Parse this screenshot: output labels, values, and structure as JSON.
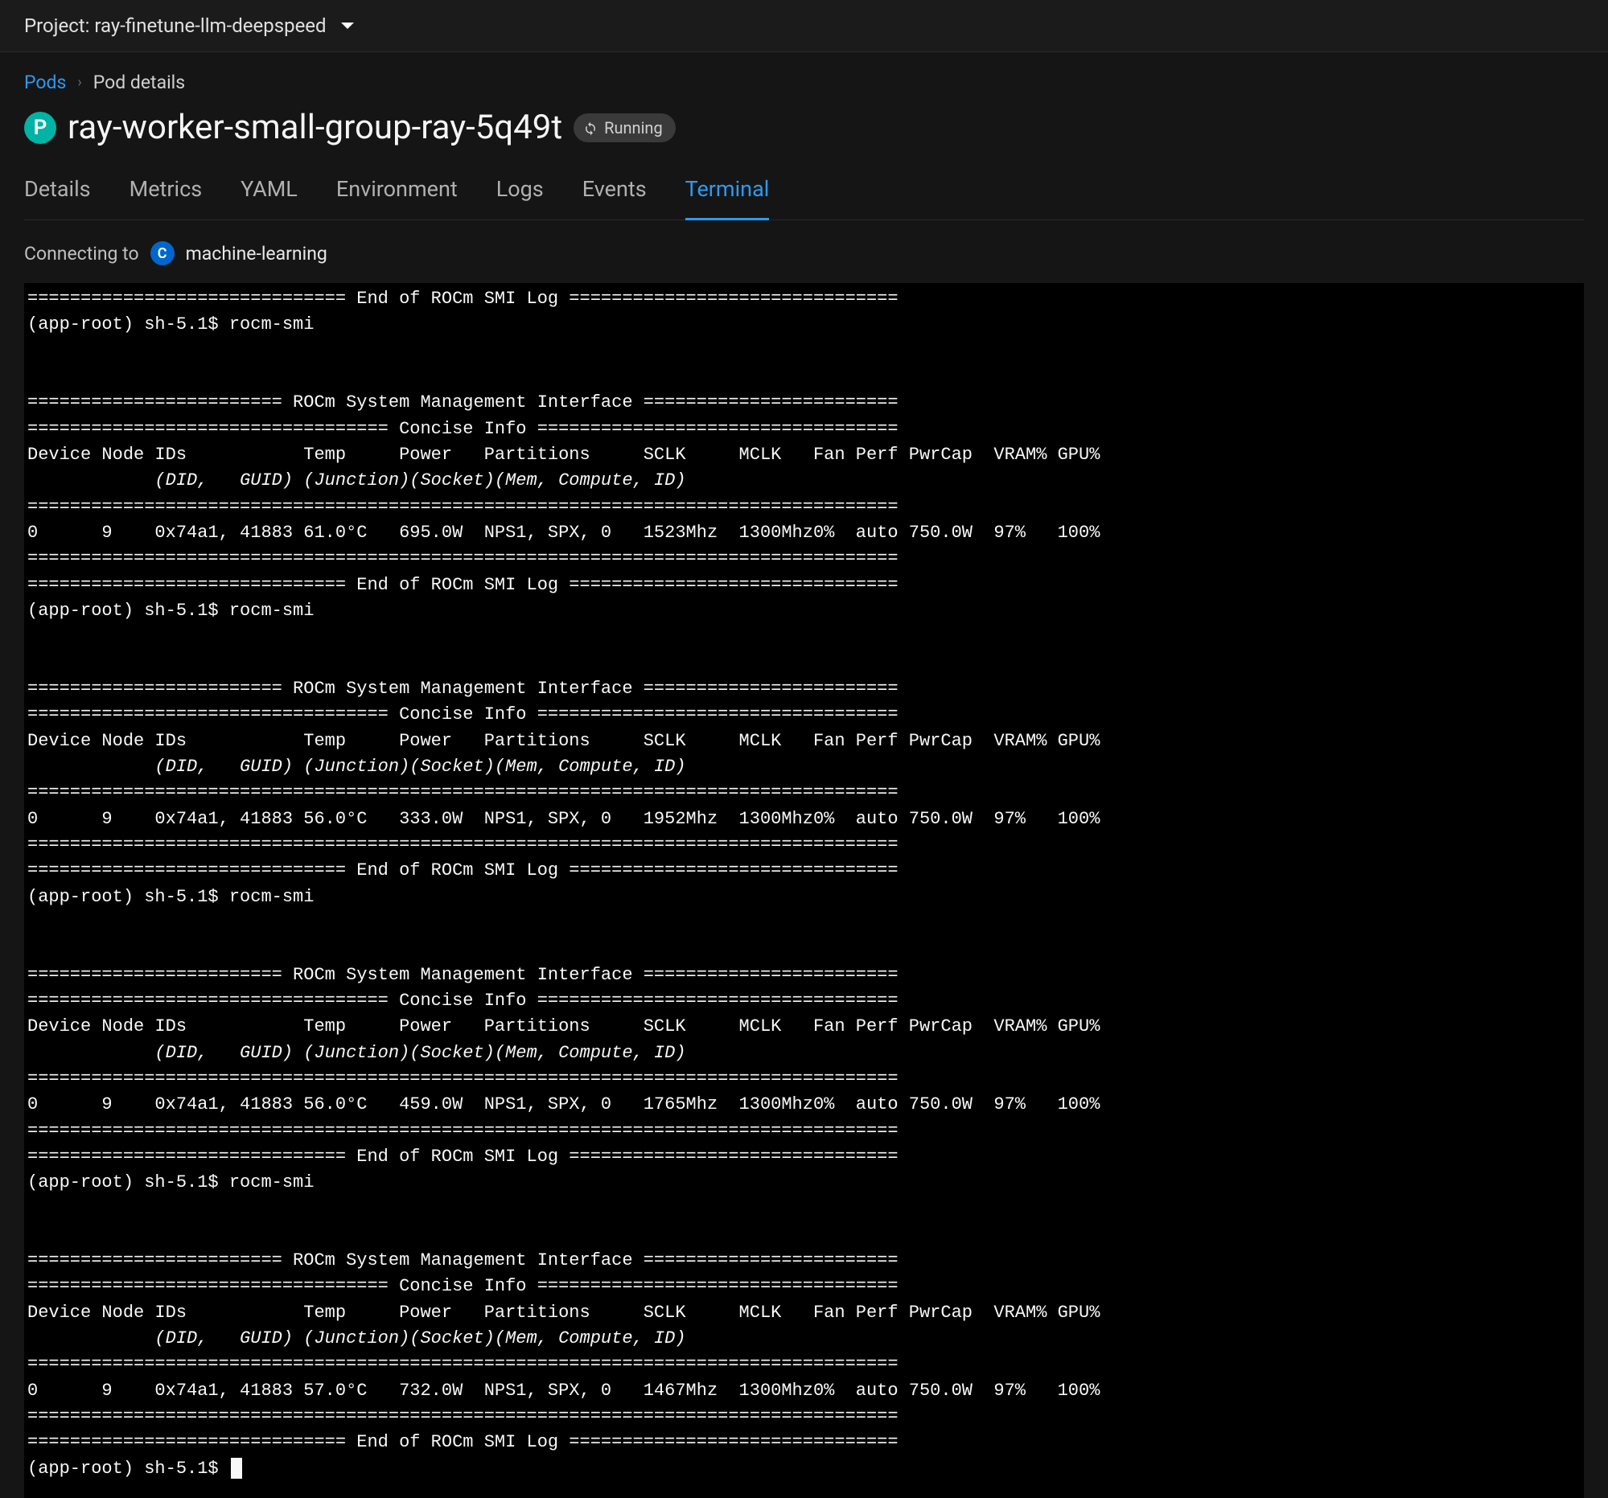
{
  "project": {
    "label": "Project: ray-finetune-llm-deepspeed"
  },
  "breadcrumb": {
    "root": "Pods",
    "current": "Pod details"
  },
  "page": {
    "title": "ray-worker-small-group-ray-5q49t",
    "pod_icon_letter": "P",
    "status": "Running"
  },
  "tabs": [
    {
      "key": "details",
      "label": "Details",
      "active": false
    },
    {
      "key": "metrics",
      "label": "Metrics",
      "active": false
    },
    {
      "key": "yaml",
      "label": "YAML",
      "active": false
    },
    {
      "key": "environment",
      "label": "Environment",
      "active": false
    },
    {
      "key": "logs",
      "label": "Logs",
      "active": false
    },
    {
      "key": "events",
      "label": "Events",
      "active": false
    },
    {
      "key": "terminal",
      "label": "Terminal",
      "active": true
    }
  ],
  "connecting": {
    "label": "Connecting to",
    "icon_letter": "C",
    "container": "machine-learning"
  },
  "terminal": {
    "prompt": "(app-root) sh-5.1$",
    "command": "rocm-smi",
    "title_interface": "ROCm System Management Interface",
    "title_concise": "Concise Info",
    "title_endlog": "End of ROCm SMI Log",
    "headers": {
      "line1": [
        "Device",
        "Node",
        "IDs",
        "Temp",
        "Power",
        "Partitions",
        "SCLK",
        "MCLK",
        "Fan",
        "Perf",
        "PwrCap",
        "VRAM%",
        "GPU%"
      ],
      "line2": [
        "(DID,",
        "GUID)",
        "(Junction)",
        "(Socket)",
        "(Mem, Compute, ID)"
      ]
    },
    "runs": [
      {
        "device": "0",
        "node": "9",
        "did": "0x74a1,",
        "guid": "41883",
        "temp": "61.0°C",
        "power": "695.0W",
        "partitions": "NPS1, SPX, 0",
        "sclk": "1523Mhz",
        "mclk": "1300Mhz",
        "fan": "0%",
        "perf": "auto",
        "pwrcap": "750.0W",
        "vram": "97%",
        "gpu": "100%"
      },
      {
        "device": "0",
        "node": "9",
        "did": "0x74a1,",
        "guid": "41883",
        "temp": "56.0°C",
        "power": "333.0W",
        "partitions": "NPS1, SPX, 0",
        "sclk": "1952Mhz",
        "mclk": "1300Mhz",
        "fan": "0%",
        "perf": "auto",
        "pwrcap": "750.0W",
        "vram": "97%",
        "gpu": "100%"
      },
      {
        "device": "0",
        "node": "9",
        "did": "0x74a1,",
        "guid": "41883",
        "temp": "56.0°C",
        "power": "459.0W",
        "partitions": "NPS1, SPX, 0",
        "sclk": "1765Mhz",
        "mclk": "1300Mhz",
        "fan": "0%",
        "perf": "auto",
        "pwrcap": "750.0W",
        "vram": "97%",
        "gpu": "100%"
      },
      {
        "device": "0",
        "node": "9",
        "did": "0x74a1,",
        "guid": "41883",
        "temp": "57.0°C",
        "power": "732.0W",
        "partitions": "NPS1, SPX, 0",
        "sclk": "1467Mhz",
        "mclk": "1300Mhz",
        "fan": "0%",
        "perf": "auto",
        "pwrcap": "750.0W",
        "vram": "97%",
        "gpu": "100%"
      }
    ]
  }
}
